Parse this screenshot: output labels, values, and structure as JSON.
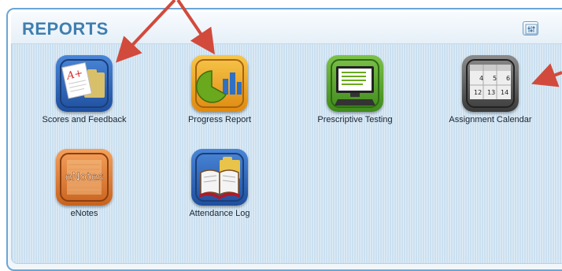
{
  "panel": {
    "title": "REPORTS",
    "settings_icon": "sliders-icon"
  },
  "tiles": [
    {
      "label": "Scores and Feedback",
      "icon": "scores-feedback-icon"
    },
    {
      "label": "Progress Report",
      "icon": "progress-report-icon"
    },
    {
      "label": "Prescriptive Testing",
      "icon": "prescriptive-testing-icon"
    },
    {
      "label": "Assignment Calendar",
      "icon": "assignment-calendar-icon"
    },
    {
      "label": "eNotes",
      "icon": "enotes-icon"
    },
    {
      "label": "Attendance Log",
      "icon": "attendance-log-icon"
    }
  ],
  "icon_text": {
    "scores_grade": "A+",
    "enotes_logo": "eNotes",
    "calendar_days": [
      "4",
      "5",
      "6",
      "12",
      "13",
      "14"
    ]
  },
  "colors": {
    "title": "#3f7fb0",
    "annotation_arrow": "#d24a3c"
  }
}
